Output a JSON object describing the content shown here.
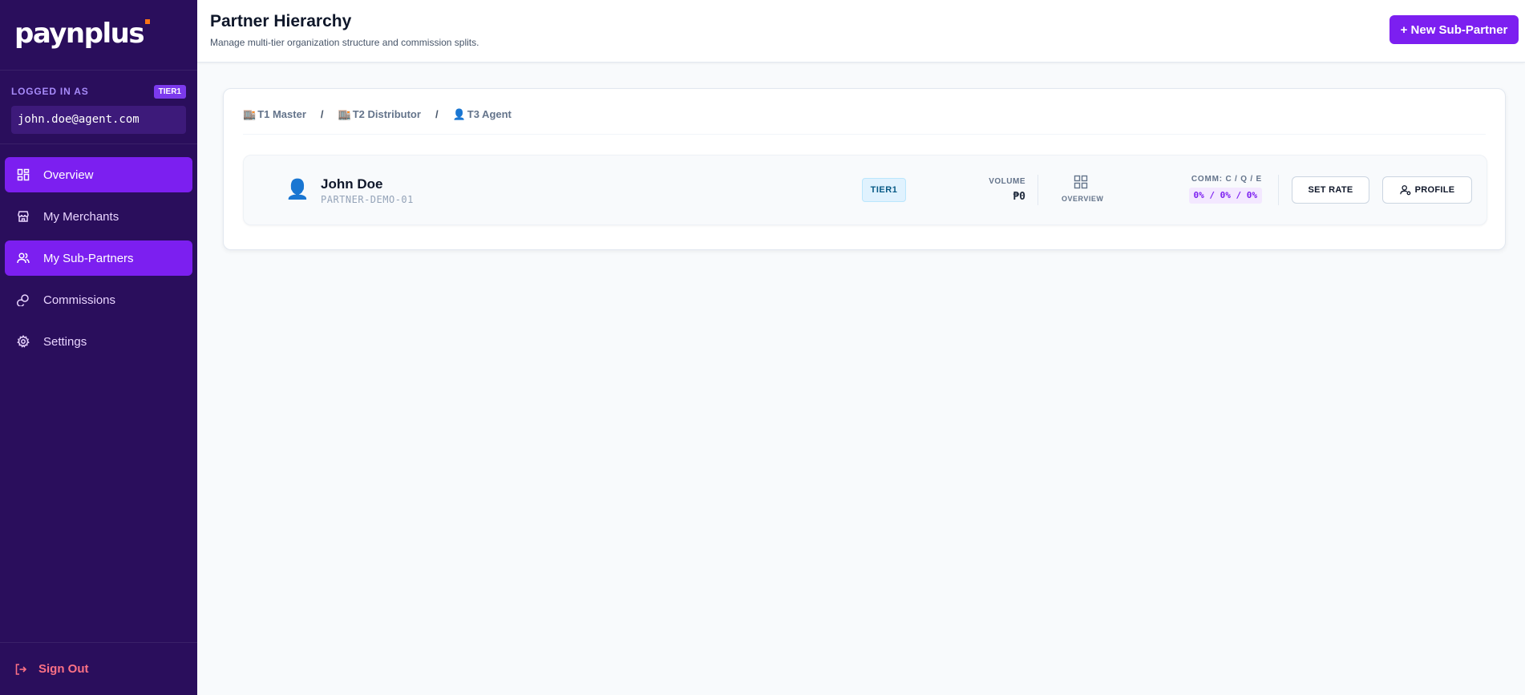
{
  "brand": {
    "logo_text": "paynplus",
    "accent": "#f97316"
  },
  "colors": {
    "sidebar_bg": "#2a0e5c",
    "primary": "#7c1ff0",
    "danger": "#fb7185"
  },
  "session": {
    "logged_in_label": "LOGGED IN AS",
    "tier": "TIER1",
    "email": "john.doe@agent.com"
  },
  "nav": {
    "items": [
      {
        "label": "Overview",
        "icon": "grid-icon",
        "active": true
      },
      {
        "label": "My Merchants",
        "icon": "store-icon",
        "active": false
      },
      {
        "label": "My Sub-Partners",
        "icon": "users-icon",
        "active": true
      },
      {
        "label": "Commissions",
        "icon": "coins-icon",
        "active": false
      },
      {
        "label": "Settings",
        "icon": "gear-icon",
        "active": false
      }
    ],
    "sign_out": "Sign Out"
  },
  "header": {
    "title": "Partner Hierarchy",
    "subtitle": "Manage multi-tier organization structure and commission splits.",
    "new_button": "+ New Sub-Partner"
  },
  "hierarchy": {
    "breadcrumbs": [
      {
        "icon": "🏬",
        "label": "T1 Master"
      },
      {
        "icon": "🏬",
        "label": "T2 Distributor"
      },
      {
        "icon": "👤",
        "label": "T3 Agent"
      }
    ],
    "separator": "/",
    "partner": {
      "avatar": "👤",
      "name": "John Doe",
      "code": "PARTNER-DEMO-01",
      "tier": "TIER1",
      "volume_label": "VOLUME",
      "volume_value": "₱0",
      "overview_label": "OVERVIEW",
      "commission_label": "COMM: C / Q / E",
      "commission_value": "0% / 0% / 0%",
      "set_rate": "SET RATE",
      "profile": "PROFILE"
    }
  }
}
